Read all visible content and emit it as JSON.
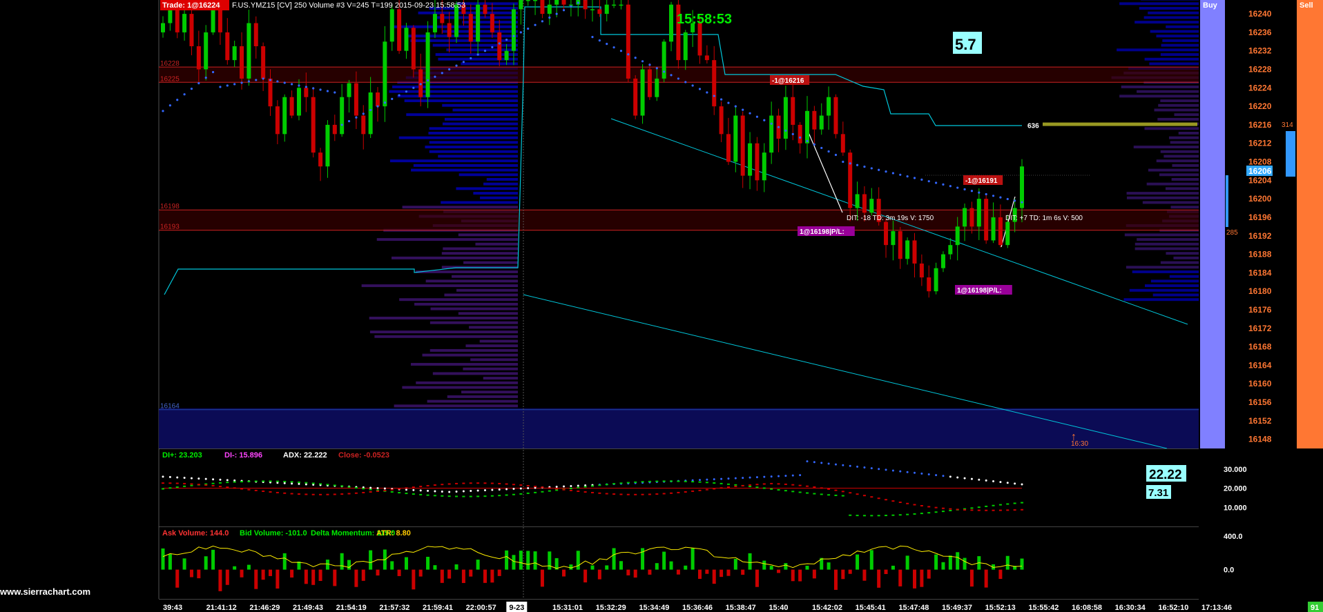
{
  "header": {
    "trade": "Trade: 1@16224",
    "info": "F.US.YMZ15 [CV]  250 Volume  #3 V=245 T=199 2015-09-23 15:58:53",
    "clock": "15:58:53",
    "value_box": "5.7"
  },
  "buttons": {
    "buy": "Buy",
    "sell": "Sell"
  },
  "watermark": "www.sierrachart.com",
  "corner": "91",
  "colors": {
    "bull": "#00cc00",
    "bear": "#cc0000",
    "dots": "#3366ff",
    "profile": "#000088",
    "cyan": "#00c8dc",
    "buy": "#8080ff",
    "sell": "#ff7733"
  },
  "chart_data": [
    {
      "type": "candlestick",
      "ylim": [
        16146,
        16243
      ],
      "y_ticks": [
        16240,
        16236,
        16232,
        16228,
        16224,
        16220,
        16216,
        16212,
        16208,
        16204,
        16200,
        16196,
        16192,
        16188,
        16184,
        16180,
        16176,
        16172,
        16168,
        16164,
        16160,
        16156,
        16152,
        16148
      ],
      "current_price": "16206",
      "x_labels": [
        "39:43",
        "21:41:12",
        "21:46:29",
        "21:49:43",
        "21:54:19",
        "21:57:32",
        "21:59:41",
        "22:00:57",
        "9-23",
        "15:31:01",
        "15:32:29",
        "15:34:49",
        "15:36:46",
        "15:38:47",
        "15:40",
        "15:42:02",
        "15:45:41",
        "15:47:48",
        "15:49:37",
        "15:52:13",
        "15:55:42",
        "16:08:58",
        "16:30:34",
        "16:52:10",
        "17:13:46"
      ],
      "closes": [
        16238,
        16242,
        16236,
        16240,
        16233,
        16228,
        16236,
        16241,
        16236,
        16230,
        16233,
        16226,
        16238,
        16233,
        16226,
        16220,
        16214,
        16222,
        16218,
        16224,
        16222,
        16210,
        16207,
        16216,
        16214,
        16222,
        16225,
        16218,
        16214,
        16223,
        16220,
        16234,
        16241,
        16232,
        16237,
        16228,
        16222,
        16236,
        16240,
        16238,
        16235,
        16242,
        16240,
        16234,
        16242,
        16240,
        16236,
        16230,
        16232,
        16241,
        16243,
        16243,
        16243,
        16240,
        16242,
        16243,
        16242,
        16242,
        16243,
        16241,
        16241,
        16240,
        16242,
        16242,
        16242,
        16226,
        16218,
        16228,
        16222,
        16226,
        16234,
        16242,
        16230,
        16236,
        16238,
        16231,
        16230,
        16220,
        16214,
        16208,
        16218,
        16205,
        16212,
        16204,
        16210,
        16218,
        16213,
        16222,
        16216,
        16212,
        16219,
        16215,
        16218,
        16222,
        16214,
        16210,
        16198,
        16201,
        16197,
        16200,
        16195,
        16190,
        16193,
        16187,
        16191,
        16186,
        16183,
        16180,
        16185,
        16188,
        16190,
        16194,
        16198,
        16194,
        16200,
        16191,
        16196,
        16190,
        16195,
        16198,
        16207
      ],
      "profile_lines": [
        {
          "label": "16228",
          "value": 16228.5,
          "color": "#cc2222"
        },
        {
          "label": "16225",
          "value": 16225.2,
          "color": "#cc2222"
        },
        {
          "label": "16198",
          "value": 16197.6,
          "color": "#cc2222"
        },
        {
          "label": "16193",
          "value": 16193.2,
          "color": "#cc2222"
        },
        {
          "label": "16164",
          "value": 16154.4,
          "color": "#2244aa"
        }
      ],
      "trade_labels": [
        {
          "text": "-1@16216",
          "style": "sell"
        },
        {
          "text": "-1@16191",
          "style": "sell"
        },
        {
          "text": "1@16198|P/L:",
          "style": "buy"
        },
        {
          "text": "1@16198|P/L:",
          "style": "buy"
        }
      ],
      "annotations": [
        "DIT: -18  TD: 3m 19s  V: 1750",
        "DIT: +7  TD: 1m 6s  V: 500"
      ],
      "marker_636": "636",
      "time_marker": "16:30",
      "dom_ladder": {
        "top_value": "314",
        "bottom_value": "285"
      }
    },
    {
      "type": "line",
      "legend": [
        "DI+: 23.203",
        "DI-: 15.896",
        "ADX: 22.222",
        "Close: -0.0523"
      ],
      "value_boxes": [
        "22.22",
        "7.31"
      ],
      "y_ticks": [
        "30.000",
        "20.000",
        "10.000"
      ],
      "ylim": [
        0,
        40
      ],
      "reference_line": 20
    },
    {
      "type": "bar",
      "legend": [
        "Ask Volume: 144.0",
        "Bid Volume: -101.0",
        "Delta Momentum: 119.0",
        "ATR: 8.80"
      ],
      "y_ticks": [
        "400.0",
        "0.0"
      ],
      "ylim": [
        -350,
        500
      ]
    }
  ]
}
